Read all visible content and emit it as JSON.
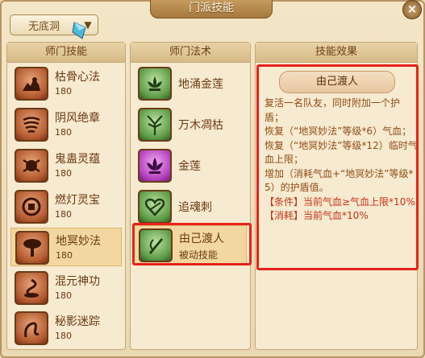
{
  "window": {
    "title": "门派技能",
    "close": "×"
  },
  "dropdown": {
    "label": "无底洞",
    "arrow": "▼"
  },
  "left_panel": {
    "header": "师门技能",
    "items": [
      {
        "name": "枯骨心法",
        "level": "180"
      },
      {
        "name": "阴风绝章",
        "level": "180"
      },
      {
        "name": "鬼蛊灵蕴",
        "level": "180"
      },
      {
        "name": "燃灯灵宝",
        "level": "180"
      },
      {
        "name": "地冥妙法",
        "level": "180"
      },
      {
        "name": "混元神功",
        "level": "180"
      },
      {
        "name": "秘影迷踪",
        "level": "180"
      }
    ]
  },
  "middle_panel": {
    "header": "师门法术",
    "items": [
      {
        "name": "地涌金莲",
        "sub": ""
      },
      {
        "name": "万木凋枯",
        "sub": ""
      },
      {
        "name": "金莲",
        "sub": ""
      },
      {
        "name": "追魂刺",
        "sub": ""
      },
      {
        "name": "由己渡人",
        "sub": "被动技能"
      }
    ]
  },
  "right_panel": {
    "header": "技能效果",
    "effect_title": "由己渡人",
    "lines": [
      "复活一名队友，同时附加一个护盾；",
      "恢复（“地冥妙法”等级*6）气血；",
      "恢复（“地冥妙法”等级*12）临时气血上限；",
      "增加（消耗气血+“地冥妙法”等级*5）的护盾值。"
    ],
    "cond_lines": [
      "【条件】当前气血≥气血上限*10%",
      "【消耗】当前气血*10%"
    ]
  },
  "colors": {
    "highlight": "#e8221b",
    "text": "#8f4c17",
    "accent_red": "#c9331a"
  },
  "icons": {
    "left": [
      "skull-fire-icon",
      "wind-swirl-icon",
      "bug-demon-icon",
      "lamp-coin-icon",
      "tree-silhouette-icon",
      "swirl-lotus-icon",
      "shadow-vine-icon"
    ],
    "middle": [
      "golden-lotus-icon",
      "withered-tree-icon",
      "lotus-icon",
      "heart-thorn-icon",
      "dagger-feather-icon"
    ]
  }
}
